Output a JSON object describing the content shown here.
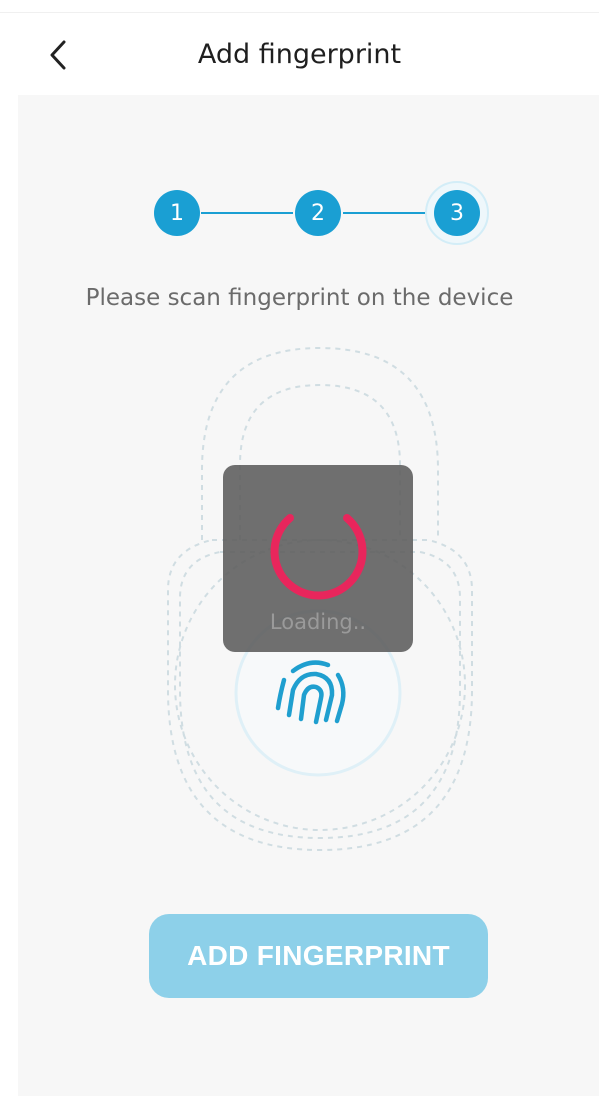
{
  "header": {
    "back_icon": "chevron-left-icon",
    "title": "Add fingerprint"
  },
  "stepper": {
    "steps": [
      "1",
      "2",
      "3"
    ],
    "active_step": 3
  },
  "instruction": "Please scan fingerprint on the device",
  "illustration": {
    "icon": "fingerprint-icon"
  },
  "loading": {
    "text": "Loading..",
    "spinner_color": "#e8265c"
  },
  "actions": {
    "add_fingerprint_label": "ADD FINGERPRINT"
  },
  "colors": {
    "accent": "#1a9fd3",
    "button": "#8dd0e9",
    "panel": "#f7f7f7"
  }
}
